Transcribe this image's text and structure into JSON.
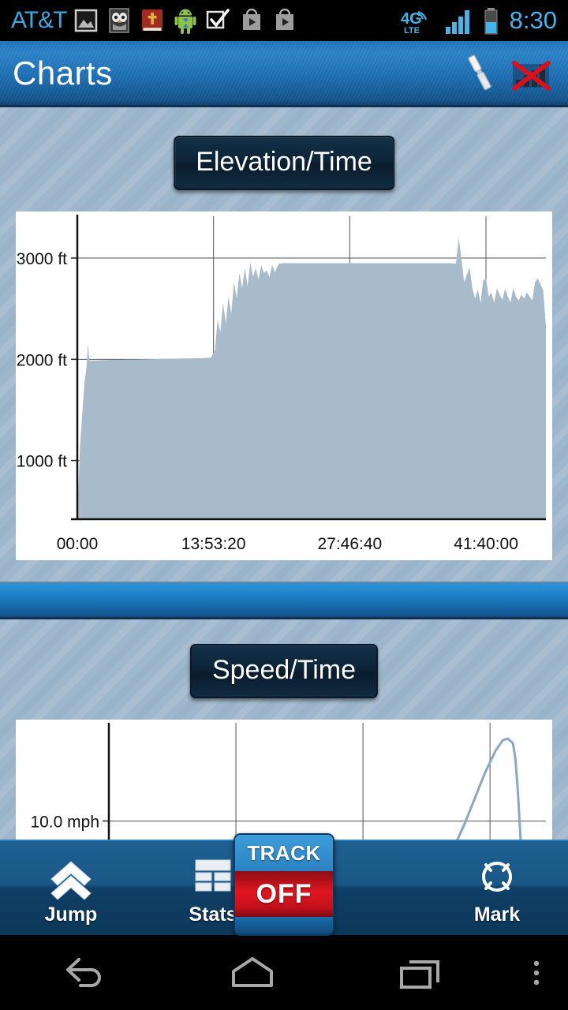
{
  "statusbar": {
    "carrier": "AT&T",
    "clock": "8:30",
    "network_label": "4G",
    "network_sub": "LTE",
    "icons": [
      {
        "name": "gallery-icon",
        "label": "Gallery"
      },
      {
        "name": "owl-app-icon",
        "label": "Owl App"
      },
      {
        "name": "bible-app-icon",
        "label": "Bible"
      },
      {
        "name": "android-app-icon",
        "label": "Android App"
      },
      {
        "name": "checkbox-task-icon",
        "label": "Tasks"
      },
      {
        "name": "play-store-icon",
        "label": "Play Store"
      },
      {
        "name": "play-store-icon-2",
        "label": "Play Store"
      }
    ]
  },
  "titlebar": {
    "title": "Charts",
    "actions": [
      {
        "name": "satellite-icon",
        "label": "GPS Satellite"
      },
      {
        "name": "no-signal-icon",
        "label": "No Signal"
      }
    ]
  },
  "main": {
    "elevation_button_label": "Elevation/Time",
    "speed_button_label": "Speed/Time"
  },
  "toolbar": {
    "items": [
      {
        "name": "jump",
        "label": "Jump",
        "icon": "double-chevron-up-icon"
      },
      {
        "name": "stats",
        "label": "Stats",
        "icon": "table-grid-icon"
      },
      {
        "name": "mark",
        "label": "Mark",
        "icon": "target-circle-icon"
      }
    ],
    "track_button": {
      "top_label": "TRACK",
      "state_label": "OFF",
      "on_color": "#2a82c3",
      "off_color": "#e01621"
    }
  },
  "navbar": {
    "items": [
      {
        "name": "back",
        "label": "Back"
      },
      {
        "name": "home",
        "label": "Home"
      },
      {
        "name": "recents",
        "label": "Recent Apps"
      },
      {
        "name": "menu",
        "label": "Menu"
      }
    ]
  },
  "colors": {
    "accent_blue": "#2a84c9",
    "page_bg": "#9fb7cc",
    "chart_fill": "#a8bbcb",
    "chart_line": "#8ba8c2",
    "title_btn_bg": "#0d2438"
  },
  "chart_data": [
    {
      "type": "area",
      "title": "Elevation/Time",
      "xlabel": "",
      "ylabel": "",
      "grid": true,
      "legend": "none",
      "ytick_labels": [
        "3000 ft",
        "2000 ft",
        "1000 ft"
      ],
      "ytick_values": [
        3000,
        2000,
        1000
      ],
      "xtick_labels": [
        "00:00",
        "13:53:20",
        "27:46:40",
        "41:40:00"
      ],
      "xtick_values": [
        0,
        50000,
        100000,
        150000
      ],
      "xlim": [
        0,
        172000
      ],
      "ylim": [
        420,
        3320
      ],
      "series": [
        {
          "name": "Elevation",
          "x": [
            0,
            1000,
            2600,
            3400,
            3900,
            4400,
            5400,
            7000,
            14000,
            24000,
            34000,
            44000,
            49000,
            50500,
            51500,
            52500,
            53500,
            54500,
            55500,
            56500,
            57500,
            58500,
            59500,
            60500,
            61500,
            62500,
            63500,
            64500,
            65500,
            66500,
            67500,
            68500,
            69500,
            70500,
            71500,
            72500,
            74000,
            76000,
            80000,
            86000,
            92000,
            98000,
            104000,
            110000,
            116000,
            122000,
            128000,
            134000,
            137000,
            139000,
            140000,
            141000,
            142000,
            143000,
            144000,
            145000,
            146000,
            147000,
            148000,
            149000,
            150000,
            151000,
            152000,
            153000,
            154000,
            155000,
            156000,
            157000,
            158000,
            159000,
            160000,
            161000,
            162000,
            163000,
            164000,
            165000,
            166000,
            167000,
            168000,
            169000,
            170000,
            171000,
            172000
          ],
          "y": [
            430,
            1150,
            1760,
            1930,
            2150,
            1990,
            1985,
            1990,
            1995,
            2000,
            2005,
            2010,
            2015,
            2090,
            2390,
            2270,
            2560,
            2350,
            2620,
            2450,
            2760,
            2600,
            2850,
            2700,
            2900,
            2720,
            2960,
            2810,
            2900,
            2790,
            2930,
            2850,
            2880,
            2810,
            2930,
            2860,
            2945,
            2950,
            2950,
            2950,
            2950,
            2950,
            2950,
            2950,
            2950,
            2950,
            2950,
            2950,
            2950,
            2945,
            3200,
            2990,
            2760,
            2840,
            2900,
            2700,
            2600,
            2690,
            2560,
            2780,
            2800,
            2620,
            2660,
            2560,
            2700,
            2640,
            2580,
            2700,
            2620,
            2560,
            2700,
            2620,
            2580,
            2640,
            2600,
            2660,
            2620,
            2580,
            2760,
            2800,
            2740,
            2680,
            2330
          ]
        }
      ]
    },
    {
      "type": "line",
      "title": "Speed/Time",
      "xlabel": "",
      "ylabel": "",
      "grid": true,
      "legend": "none",
      "ytick_labels": [
        "10.0 mph"
      ],
      "ytick_values": [
        10.0
      ],
      "xtick_labels": [],
      "xlim": [
        0,
        172000
      ],
      "ylim": [
        0,
        26
      ],
      "series": [
        {
          "name": "Speed",
          "x": [
            128000,
            132000,
            136000,
            140000,
            144000,
            148000,
            152000,
            155000,
            157000,
            159000,
            160000,
            161000,
            162000,
            163000
          ],
          "y": [
            0,
            2.0,
            5.5,
            9.5,
            14.0,
            18.5,
            22.3,
            24.3,
            24.6,
            23.8,
            21.0,
            15.0,
            7.0,
            0
          ]
        }
      ]
    }
  ]
}
